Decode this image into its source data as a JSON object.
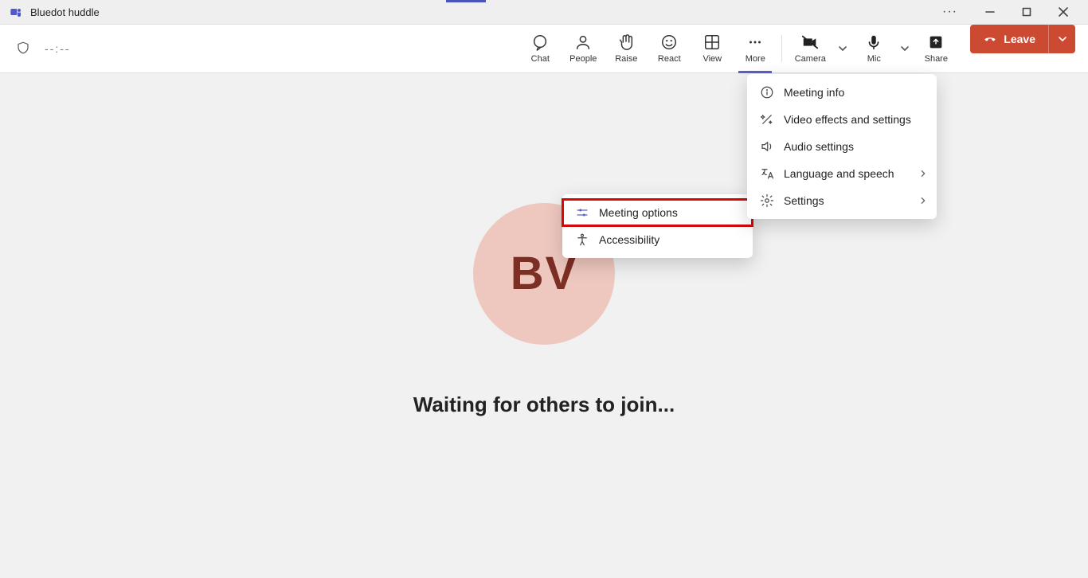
{
  "window": {
    "title": "Bluedot huddle"
  },
  "toolbar": {
    "timer": "--:--",
    "chat": "Chat",
    "people": "People",
    "raise": "Raise",
    "react": "React",
    "view": "View",
    "more": "More",
    "camera": "Camera",
    "mic": "Mic",
    "share": "Share",
    "leave": "Leave"
  },
  "meeting": {
    "avatar_initials": "BV",
    "waiting_text": "Waiting for others to join..."
  },
  "submenu": {
    "meeting_options": "Meeting options",
    "accessibility": "Accessibility"
  },
  "more_menu": {
    "meeting_info": "Meeting info",
    "video_effects": "Video effects and settings",
    "audio_settings": "Audio settings",
    "language_speech": "Language and speech",
    "settings": "Settings"
  }
}
